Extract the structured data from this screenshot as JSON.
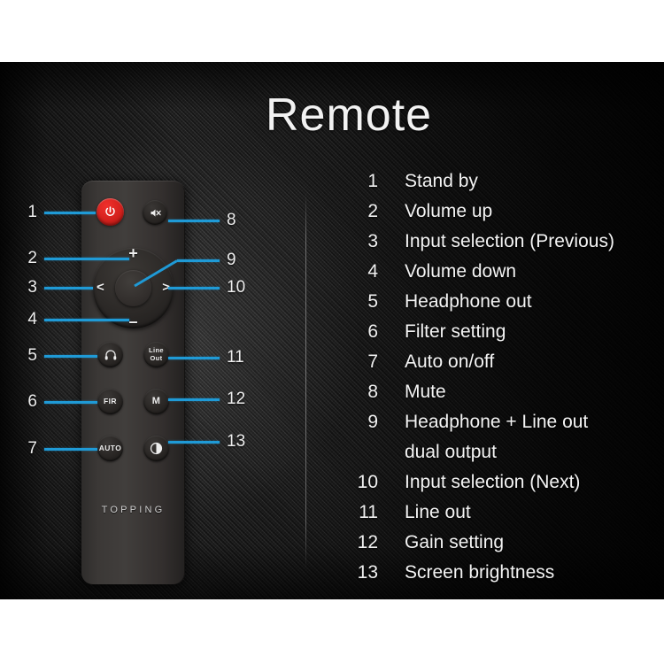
{
  "page": {
    "title": "Remote",
    "brand": "TOPPING"
  },
  "remote": {
    "buttons": [
      {
        "id": "power",
        "icon": "power-icon",
        "label": "",
        "callout": "1"
      },
      {
        "id": "mute",
        "icon": "mute-icon",
        "label": "",
        "callout": "8"
      },
      {
        "id": "vol-up",
        "icon": "plus-icon",
        "label": "+",
        "callout": "2"
      },
      {
        "id": "prev",
        "icon": "chevron-left-icon",
        "label": "<",
        "callout": "3"
      },
      {
        "id": "next",
        "icon": "chevron-right-icon",
        "label": ">",
        "callout": "10"
      },
      {
        "id": "vol-down",
        "icon": "minus-icon",
        "label": "–",
        "callout": "4"
      },
      {
        "id": "dpad-center",
        "icon": "center-icon",
        "label": "",
        "callout": "9"
      },
      {
        "id": "headphone",
        "icon": "headphone-icon",
        "label": "",
        "callout": "5"
      },
      {
        "id": "line-out",
        "icon": "text-icon",
        "label": "Line\nOut",
        "callout": "11"
      },
      {
        "id": "fir",
        "icon": "text-icon",
        "label": "FIR",
        "callout": "6"
      },
      {
        "id": "gain",
        "icon": "text-icon",
        "label": "M",
        "callout": "12"
      },
      {
        "id": "auto",
        "icon": "text-icon",
        "label": "AUTO",
        "callout": "7"
      },
      {
        "id": "brightness",
        "icon": "brightness-icon",
        "label": "",
        "callout": "13"
      }
    ],
    "labels": {
      "line_out_1": "Line",
      "line_out_2": "Out",
      "fir": "FIR",
      "gain": "M",
      "auto": "AUTO",
      "plus": "+",
      "minus": "–",
      "left": "<",
      "right": ">"
    }
  },
  "callouts": {
    "left": [
      "1",
      "2",
      "3",
      "4",
      "5",
      "6",
      "7"
    ],
    "right": [
      "8",
      "9",
      "10",
      "11",
      "12",
      "13"
    ]
  },
  "legend": {
    "items": [
      {
        "num": "1",
        "text": "Stand by"
      },
      {
        "num": "2",
        "text": "Volume up"
      },
      {
        "num": "3",
        "text": "Input selection (Previous)"
      },
      {
        "num": "4",
        "text": "Volume down"
      },
      {
        "num": "5",
        "text": "Headphone out"
      },
      {
        "num": "6",
        "text": "Filter setting"
      },
      {
        "num": "7",
        "text": "Auto on/off"
      },
      {
        "num": "8",
        "text": "Mute"
      },
      {
        "num": "9",
        "text": "Headphone + Line out"
      },
      {
        "num": "",
        "text": "dual output"
      },
      {
        "num": "10",
        "text": "Input selection (Next)"
      },
      {
        "num": "11",
        "text": "Line out"
      },
      {
        "num": "12",
        "text": "Gain setting"
      },
      {
        "num": "13",
        "text": "Screen brightness"
      }
    ]
  },
  "colors": {
    "accent_blue": "#1f9ad6",
    "power_red": "#d4211d",
    "text_white": "#f4f4f4",
    "panel_dark": "#2b2b2b"
  }
}
